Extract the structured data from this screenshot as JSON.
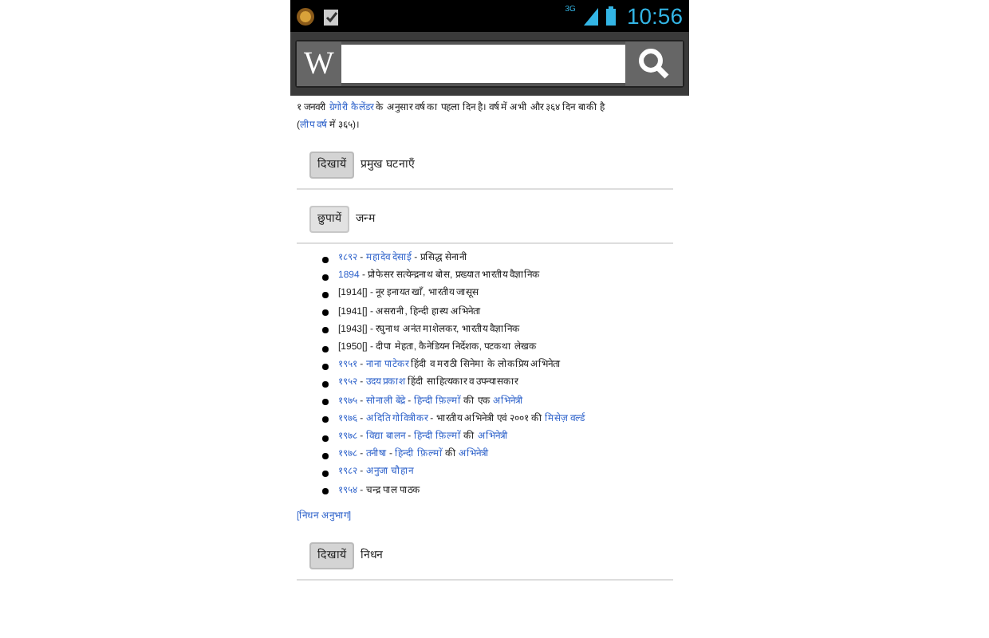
{
  "status_bar": {
    "time": "10:56",
    "network": "3G"
  },
  "search": {
    "logo": "W"
  },
  "intro": {
    "link": "ग्रेगोरी कैलेंडर",
    "before": "१ जनवरी ",
    "after": " के अनुसार वर्ष का पहला दिन है। वर्ष में अभी और ३६४ दिन बाकी है",
    "line2_link": "लीप वर्ष",
    "line2_before": "(",
    "line2_after": " में ३६५)।"
  },
  "sections": [
    {
      "button": "दिखायें",
      "title": "प्रमुख घटनाएँ",
      "expanded": false
    },
    {
      "button": "छुपायें",
      "title": "जन्म",
      "expanded": true,
      "items": [
        {
          "year": "१८९२",
          "year_link": true,
          "parts": [
            {
              "t": " - ",
              "link": false
            },
            {
              "t": "महादेव देसाई",
              "link": true
            },
            {
              "t": " - प्रसिद्ध सेनानी",
              "link": false
            }
          ]
        },
        {
          "year": "1894",
          "year_link": true,
          "parts": [
            {
              "t": " - प्रोफेसर सत्येन्द्रनाथ बोस, प्रख्यात भारतीय वैज्ञानिक",
              "link": false
            }
          ]
        },
        {
          "year": "[1914[]",
          "year_link": false,
          "parts": [
            {
              "t": " - नूर इनायत खाँ, भारतीय जासूस",
              "link": false
            }
          ]
        },
        {
          "year": "[1941[]",
          "year_link": false,
          "parts": [
            {
              "t": " - असरानी, हिन्दी हास्य अभिनेता",
              "link": false
            }
          ]
        },
        {
          "year": "[1943[]",
          "year_link": false,
          "parts": [
            {
              "t": " - रघुनाथ अनंत माशेलकर, भारतीय वैज्ञानिक",
              "link": false
            }
          ]
        },
        {
          "year": "[1950[]",
          "year_link": false,
          "parts": [
            {
              "t": " - दीपा मेहता, कैनेडियन निर्देशक, पटकथा लेखक",
              "link": false
            }
          ]
        },
        {
          "year": "१९५१",
          "year_link": true,
          "parts": [
            {
              "t": " - ",
              "link": false
            },
            {
              "t": "नाना पाटेकर",
              "link": true
            },
            {
              "t": " हिंदी व मराठी सिनेमा के लोकप्रिय अभिनेता",
              "link": false
            }
          ]
        },
        {
          "year": "१९५२",
          "year_link": true,
          "parts": [
            {
              "t": " - ",
              "link": false
            },
            {
              "t": "उदय प्रकाश",
              "link": true
            },
            {
              "t": " हिंदी साहित्यकार व उपन्यासकार",
              "link": false
            }
          ]
        },
        {
          "year": "१९७५",
          "year_link": true,
          "parts": [
            {
              "t": " - ",
              "link": false
            },
            {
              "t": "सोनाली बेंद्रे",
              "link": true
            },
            {
              "t": " - ",
              "link": false
            },
            {
              "t": "हिन्दी फ़िल्मों",
              "link": true
            },
            {
              "t": " की एक ",
              "link": false
            },
            {
              "t": "अभिनेत्री",
              "link": true
            }
          ]
        },
        {
          "year": "१९७६",
          "year_link": true,
          "parts": [
            {
              "t": " - ",
              "link": false
            },
            {
              "t": "अदिति गोवित्रीकर",
              "link": true
            },
            {
              "t": " - भारतीय अभिनेत्री एवं २००१ की ",
              "link": false
            },
            {
              "t": "मिसेज़ वर्ल्ड",
              "link": true
            }
          ]
        },
        {
          "year": "१९७८",
          "year_link": true,
          "parts": [
            {
              "t": " - ",
              "link": false
            },
            {
              "t": "विद्या बालन",
              "link": true
            },
            {
              "t": " - ",
              "link": false
            },
            {
              "t": "हिन्दी फ़िल्मों",
              "link": true
            },
            {
              "t": " की ",
              "link": false
            },
            {
              "t": "अभिनेत्री",
              "link": true
            }
          ]
        },
        {
          "year": "१९७८",
          "year_link": true,
          "parts": [
            {
              "t": " - ",
              "link": false
            },
            {
              "t": "तनीषा",
              "link": true
            },
            {
              "t": " - ",
              "link": false
            },
            {
              "t": "हिन्दी फ़िल्मों",
              "link": true
            },
            {
              "t": " की ",
              "link": false
            },
            {
              "t": "अभिनेत्री",
              "link": true
            }
          ]
        },
        {
          "year": "१९८२",
          "year_link": true,
          "parts": [
            {
              "t": " - ",
              "link": false
            },
            {
              "t": "अनुजा चौहान",
              "link": true
            }
          ]
        },
        {
          "year": "१९५४",
          "year_link": true,
          "parts": [
            {
              "t": " - चन्द्र पाल पाठक",
              "link": false
            }
          ]
        }
      ],
      "footer_link": "[निधन अनुभाग]"
    },
    {
      "button": "दिखायें",
      "title": "निधन",
      "expanded": false
    }
  ]
}
